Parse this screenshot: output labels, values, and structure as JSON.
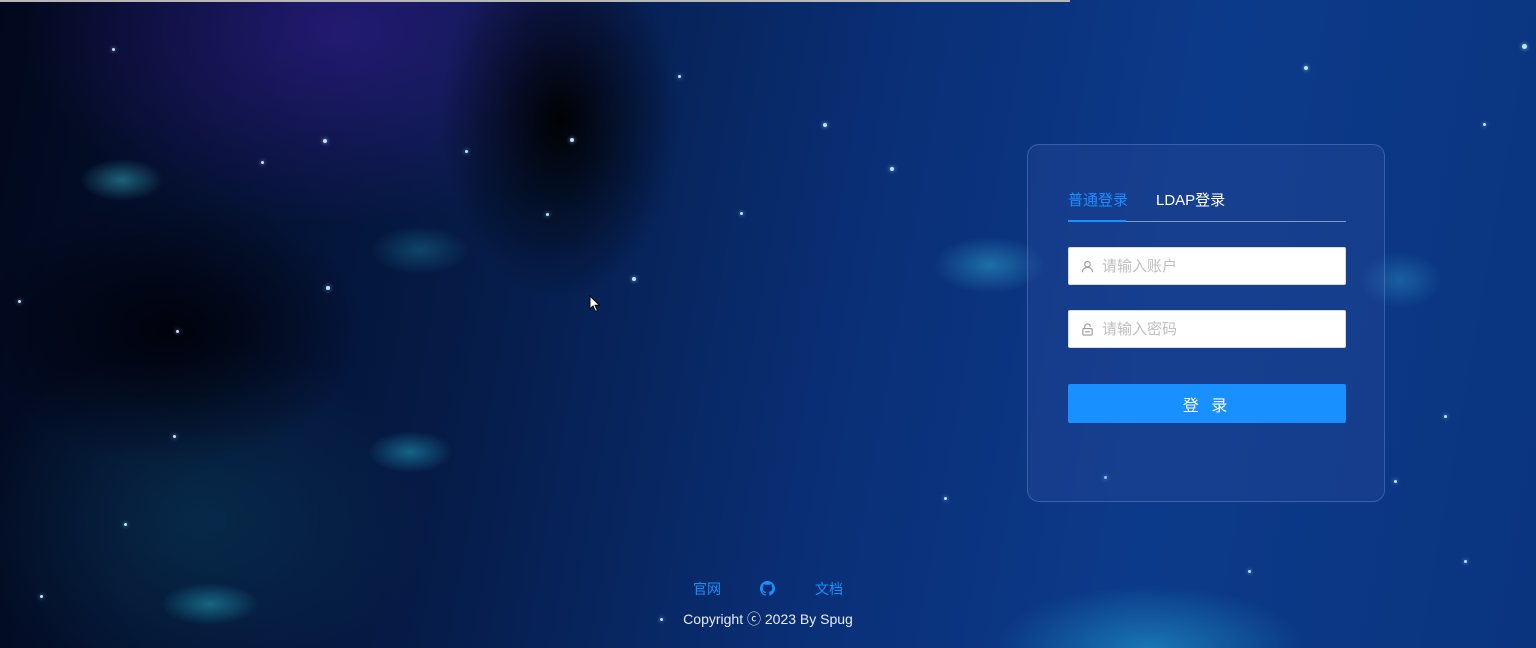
{
  "login": {
    "tabs": [
      {
        "label": "普通登录",
        "active": true
      },
      {
        "label": "LDAP登录",
        "active": false
      }
    ],
    "username": {
      "placeholder": "请输入账户",
      "value": ""
    },
    "password": {
      "placeholder": "请输入密码",
      "value": ""
    },
    "submit_label": "登 录"
  },
  "footer": {
    "links": [
      {
        "label": "官网"
      },
      {
        "icon": "github-icon"
      },
      {
        "label": "文档"
      }
    ],
    "copyright": "Copyright ⓒ 2023 By Spug"
  },
  "colors": {
    "accent": "#1890ff",
    "text_on_dark": "#ffffff"
  }
}
